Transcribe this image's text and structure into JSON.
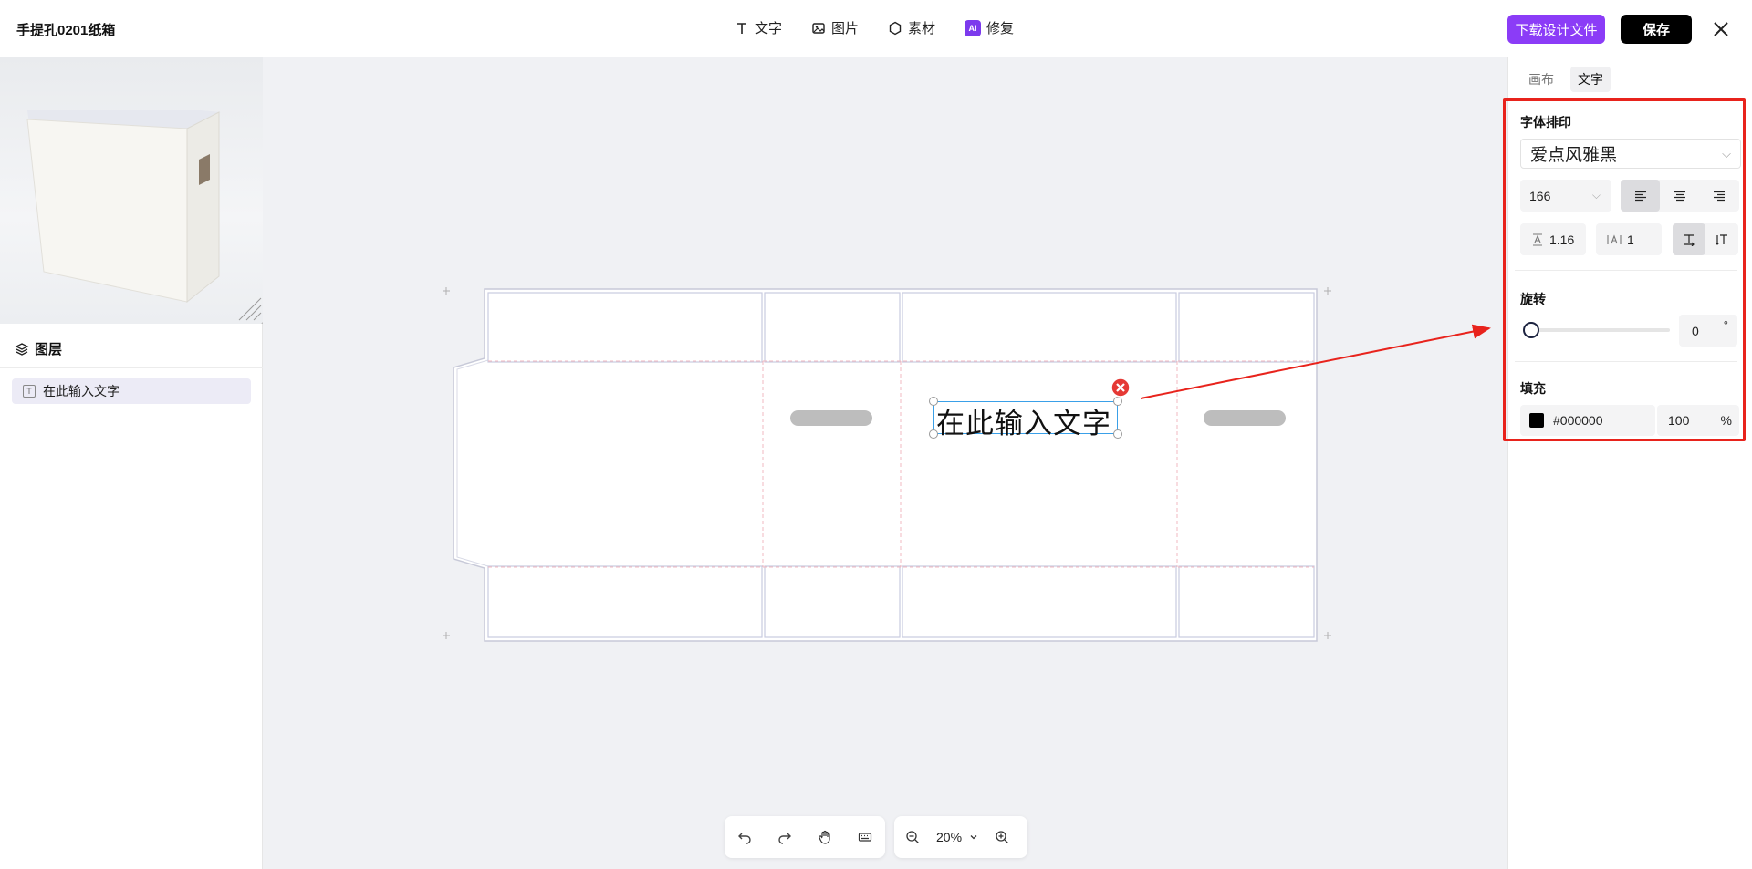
{
  "header": {
    "doc_title": "手提孔0201纸箱",
    "tools": [
      {
        "label": "文字",
        "icon": "text-icon"
      },
      {
        "label": "图片",
        "icon": "image-icon"
      },
      {
        "label": "素材",
        "icon": "hexagon-icon"
      },
      {
        "label": "修复",
        "icon": "ai-icon",
        "badge": "AI"
      }
    ],
    "download_label": "下载设计文件",
    "save_label": "保存",
    "accent_color": "#8b3cf7"
  },
  "left_panel": {
    "layers_title": "图层",
    "layers": [
      {
        "label": "在此输入文字",
        "type_badge": "T"
      }
    ]
  },
  "canvas": {
    "text_object": "在此输入文字",
    "zoom": "20%"
  },
  "right_panel": {
    "tabs": [
      {
        "label": "画布",
        "active": false
      },
      {
        "label": "文字",
        "active": true
      }
    ],
    "typography_title": "字体排印",
    "font_family": "爱点风雅黑",
    "font_size": "166",
    "line_height": "1.16",
    "letter_spacing": "1",
    "rotation_title": "旋转",
    "rotation_value": "0",
    "rotation_unit": "°",
    "fill_title": "填充",
    "fill_color": "#000000",
    "opacity": "100",
    "opacity_unit": "%"
  }
}
